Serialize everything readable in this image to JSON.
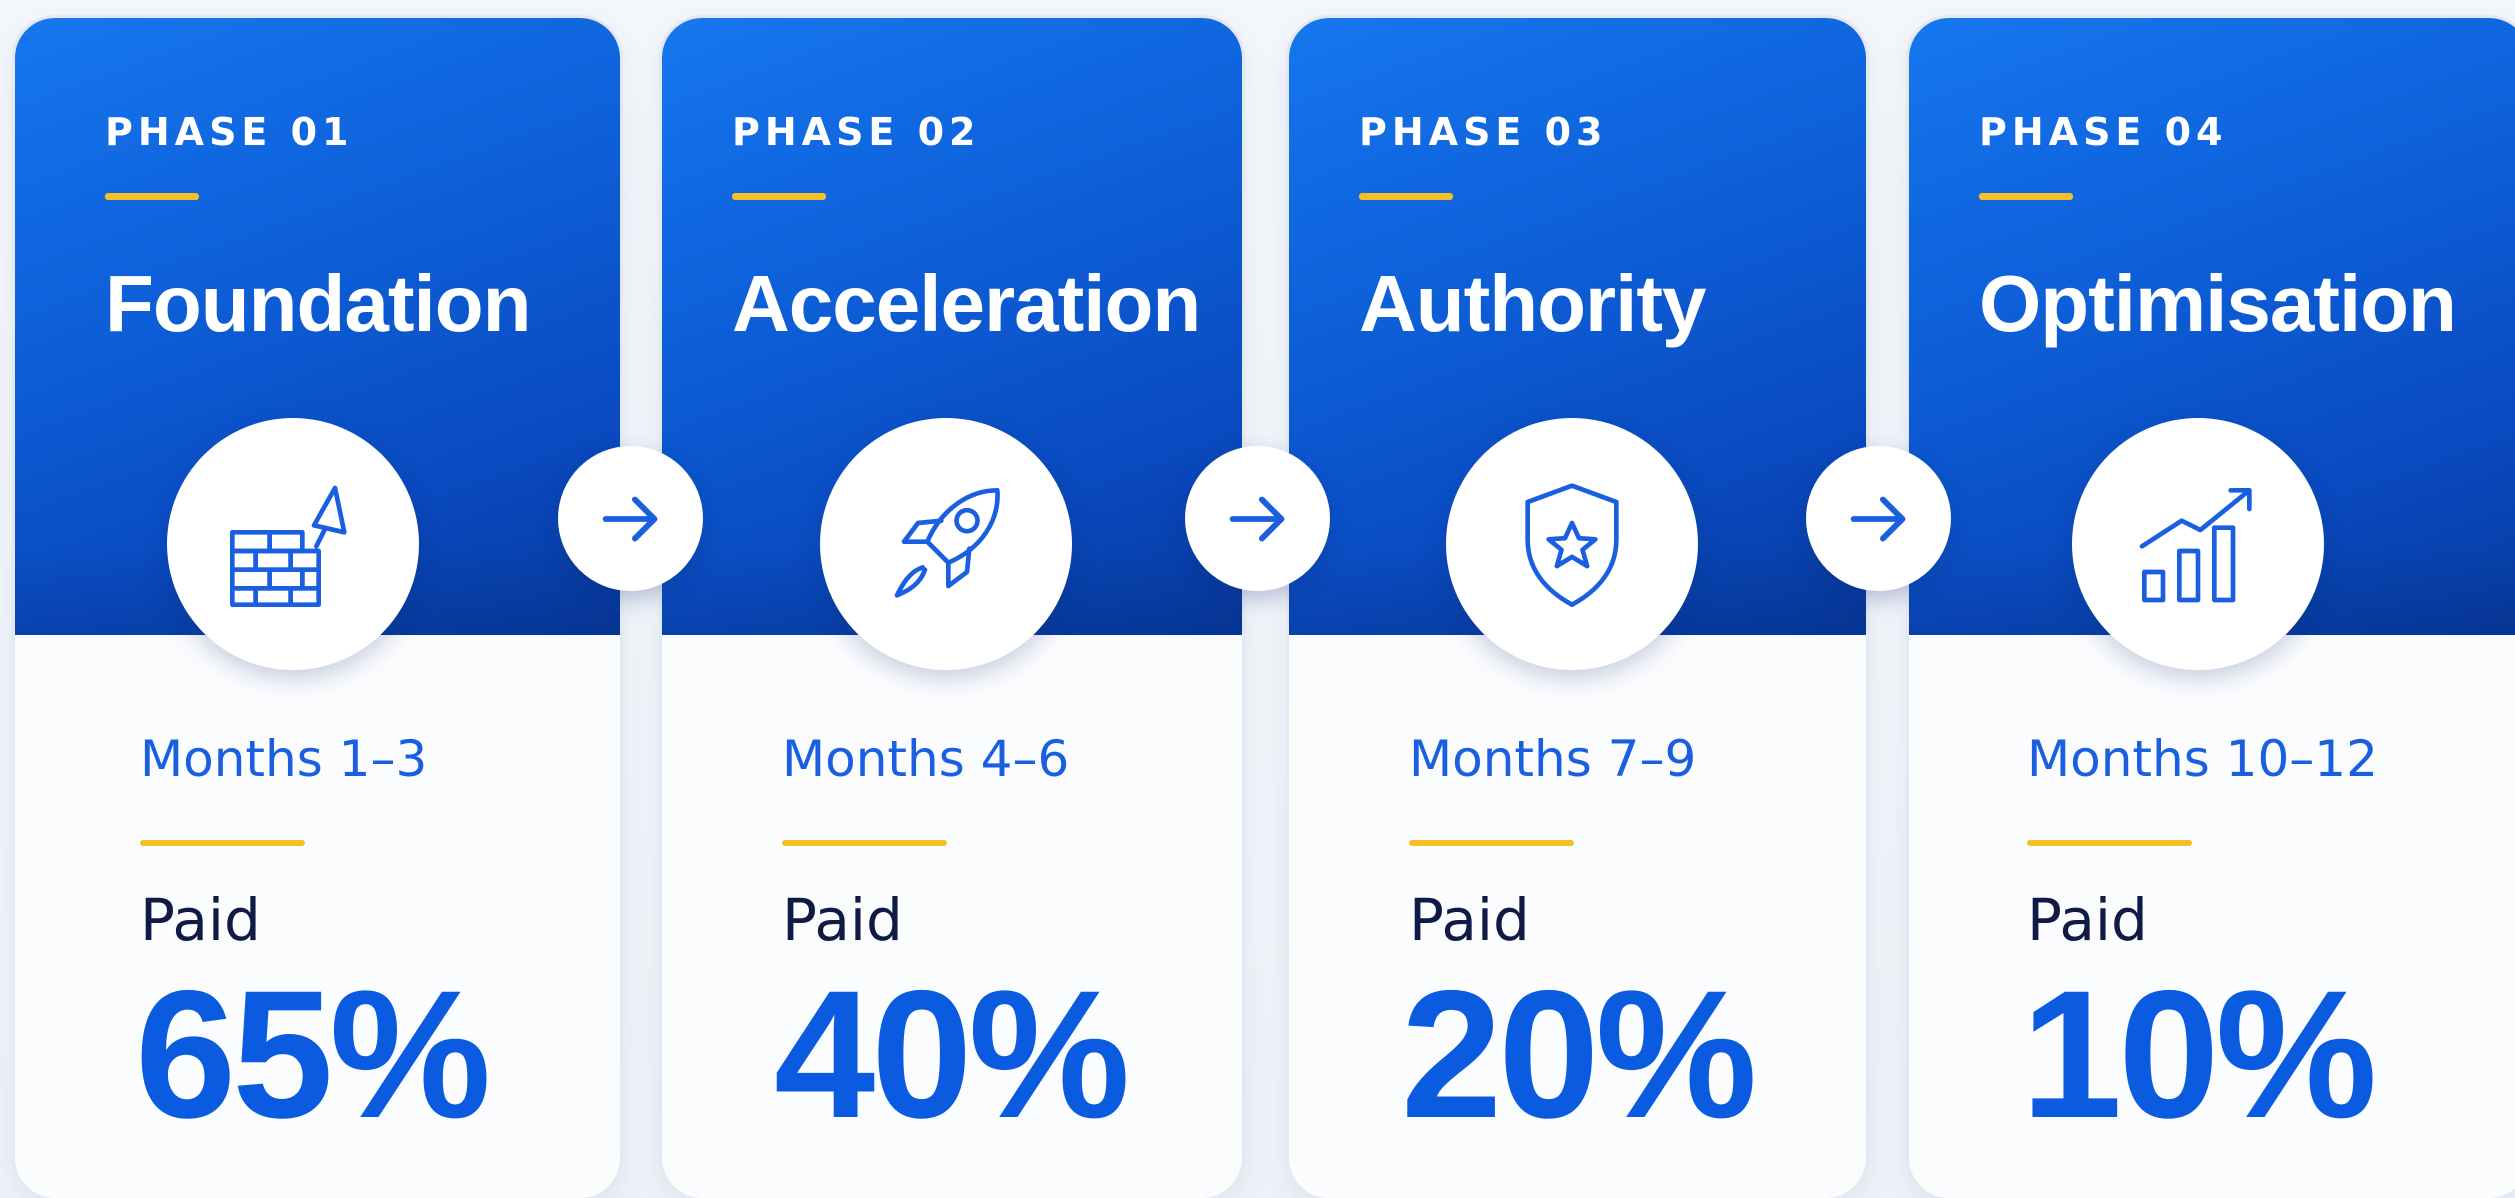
{
  "accent_color": "#0b5be0",
  "highlight_color": "#f4c027",
  "phases": [
    {
      "label": "PHASE 01",
      "title": "Foundation",
      "months": "Months 1–3",
      "paid_label": "Paid",
      "paid_value": "65%",
      "icon": "brick-wall-trowel-icon"
    },
    {
      "label": "PHASE 02",
      "title": "Acceleration",
      "months": "Months 4–6",
      "paid_label": "Paid",
      "paid_value": "40%",
      "icon": "rocket-icon"
    },
    {
      "label": "PHASE 03",
      "title": "Authority",
      "months": "Months 7–9",
      "paid_label": "Paid",
      "paid_value": "20%",
      "icon": "shield-star-icon"
    },
    {
      "label": "PHASE 04",
      "title": "Optimisation",
      "months": "Months 10–12",
      "paid_label": "Paid",
      "paid_value": "10%",
      "icon": "growth-chart-icon"
    }
  ],
  "arrows": [
    {
      "icon": "arrow-right-icon"
    },
    {
      "icon": "arrow-right-icon"
    },
    {
      "icon": "arrow-right-icon"
    }
  ]
}
